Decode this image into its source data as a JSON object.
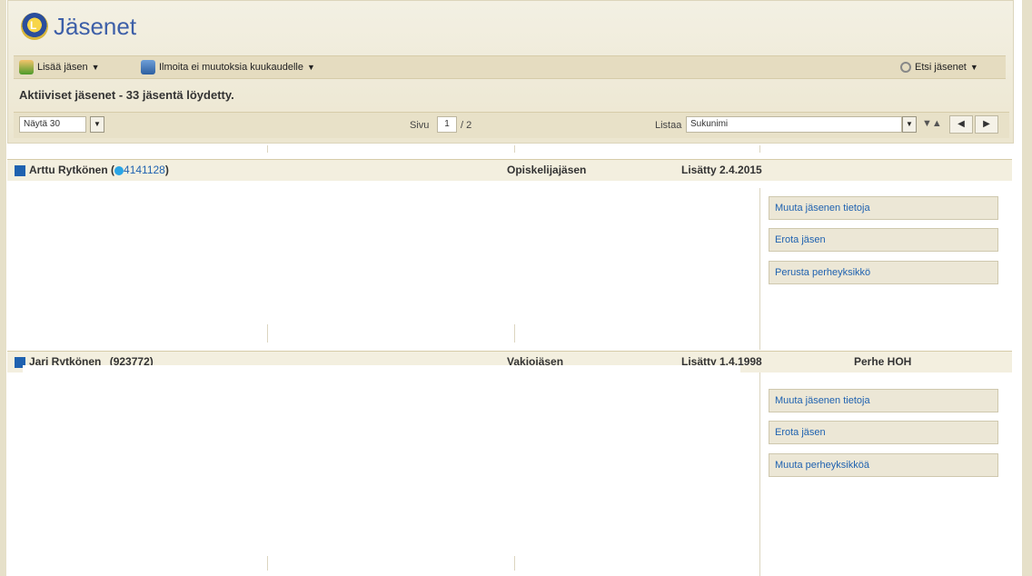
{
  "header": {
    "title": "Jäsenet",
    "logo": "lions-logo"
  },
  "toolbar": {
    "add_member": "Lisää jäsen",
    "report_no_changes": "Ilmoita ei muutoksia kuukaudelle",
    "search_members": "Etsi jäsenet"
  },
  "status": "Aktiiviset jäsenet - 33 jäsentä löydetty.",
  "controls": {
    "show_count": "Näytä 30",
    "page_label": "Sivu",
    "page_current": "1",
    "page_total": "/ 2",
    "sort_label": "Listaa",
    "sort_value": "Sukunimi"
  },
  "members": [
    {
      "name": "Arttu Rytkönen",
      "id_prefix": "(",
      "id": "4141128",
      "id_suffix": ")",
      "type": "Opiskelijajäsen",
      "added": "Lisätty 2.4.2015",
      "family": "",
      "actions": [
        "Muuta jäsenen tietoja",
        "Erota jäsen",
        "Perusta perheyksikkö"
      ]
    },
    {
      "name": "Jari Rytkönen",
      "id_prefix": "",
      "id": "(923772)",
      "id_suffix": "",
      "type": "Vakiojäsen",
      "added": "Lisätty 1.4.1998",
      "family": "Perhe HOH",
      "actions": [
        "Muuta jäsenen tietoja",
        "Erota jäsen",
        "Muuta perheyksikköä"
      ]
    }
  ],
  "colors": {
    "accent": "#1f62b0",
    "panel": "#ece6d0",
    "title": "#3d5fa8"
  }
}
